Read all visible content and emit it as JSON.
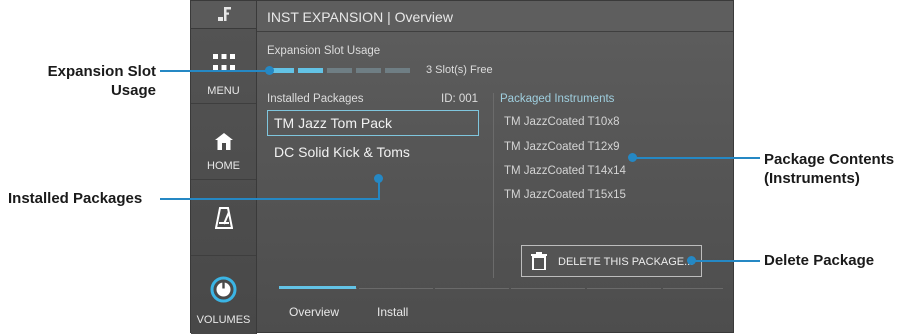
{
  "app": {
    "title": "INST EXPANSION | Overview"
  },
  "sidebar": {
    "items": [
      {
        "label": "",
        "icon": "logo-icon"
      },
      {
        "label": "MENU",
        "icon": "grid-menu-icon"
      },
      {
        "label": "HOME",
        "icon": "home-icon"
      },
      {
        "label": "",
        "icon": "metronome-icon"
      },
      {
        "label": "VOLUMES",
        "icon": "volume-knob-icon"
      }
    ]
  },
  "slot_usage": {
    "label": "Expansion Slot Usage",
    "free_text": "3 Slot(s) Free",
    "used_segments": 2,
    "total_segments": 5
  },
  "installed": {
    "header": "Installed Packages",
    "id_label": "ID: 001",
    "packages": [
      "TM Jazz Tom Pack",
      "DC Solid Kick & Toms"
    ],
    "selected_index": 0
  },
  "contents": {
    "header": "Packaged Instruments",
    "instruments": [
      "TM JazzCoated T10x8",
      "TM JazzCoated T12x9",
      "TM JazzCoated T14x14",
      "TM JazzCoated T15x15"
    ]
  },
  "delete_button": {
    "label": "DELETE THIS PACKAGE..."
  },
  "tabs": [
    {
      "label": "Overview",
      "active": true
    },
    {
      "label": "Install",
      "active": false
    }
  ],
  "callouts": {
    "slot_usage": [
      "Expansion Slot",
      "Usage"
    ],
    "installed": "Installed Packages",
    "contents": [
      "Package Contents",
      "(Instruments)"
    ],
    "delete": "Delete Package"
  },
  "colors": {
    "accent": "#63c3e6",
    "callout": "#2588c4",
    "panel": "#505050"
  }
}
